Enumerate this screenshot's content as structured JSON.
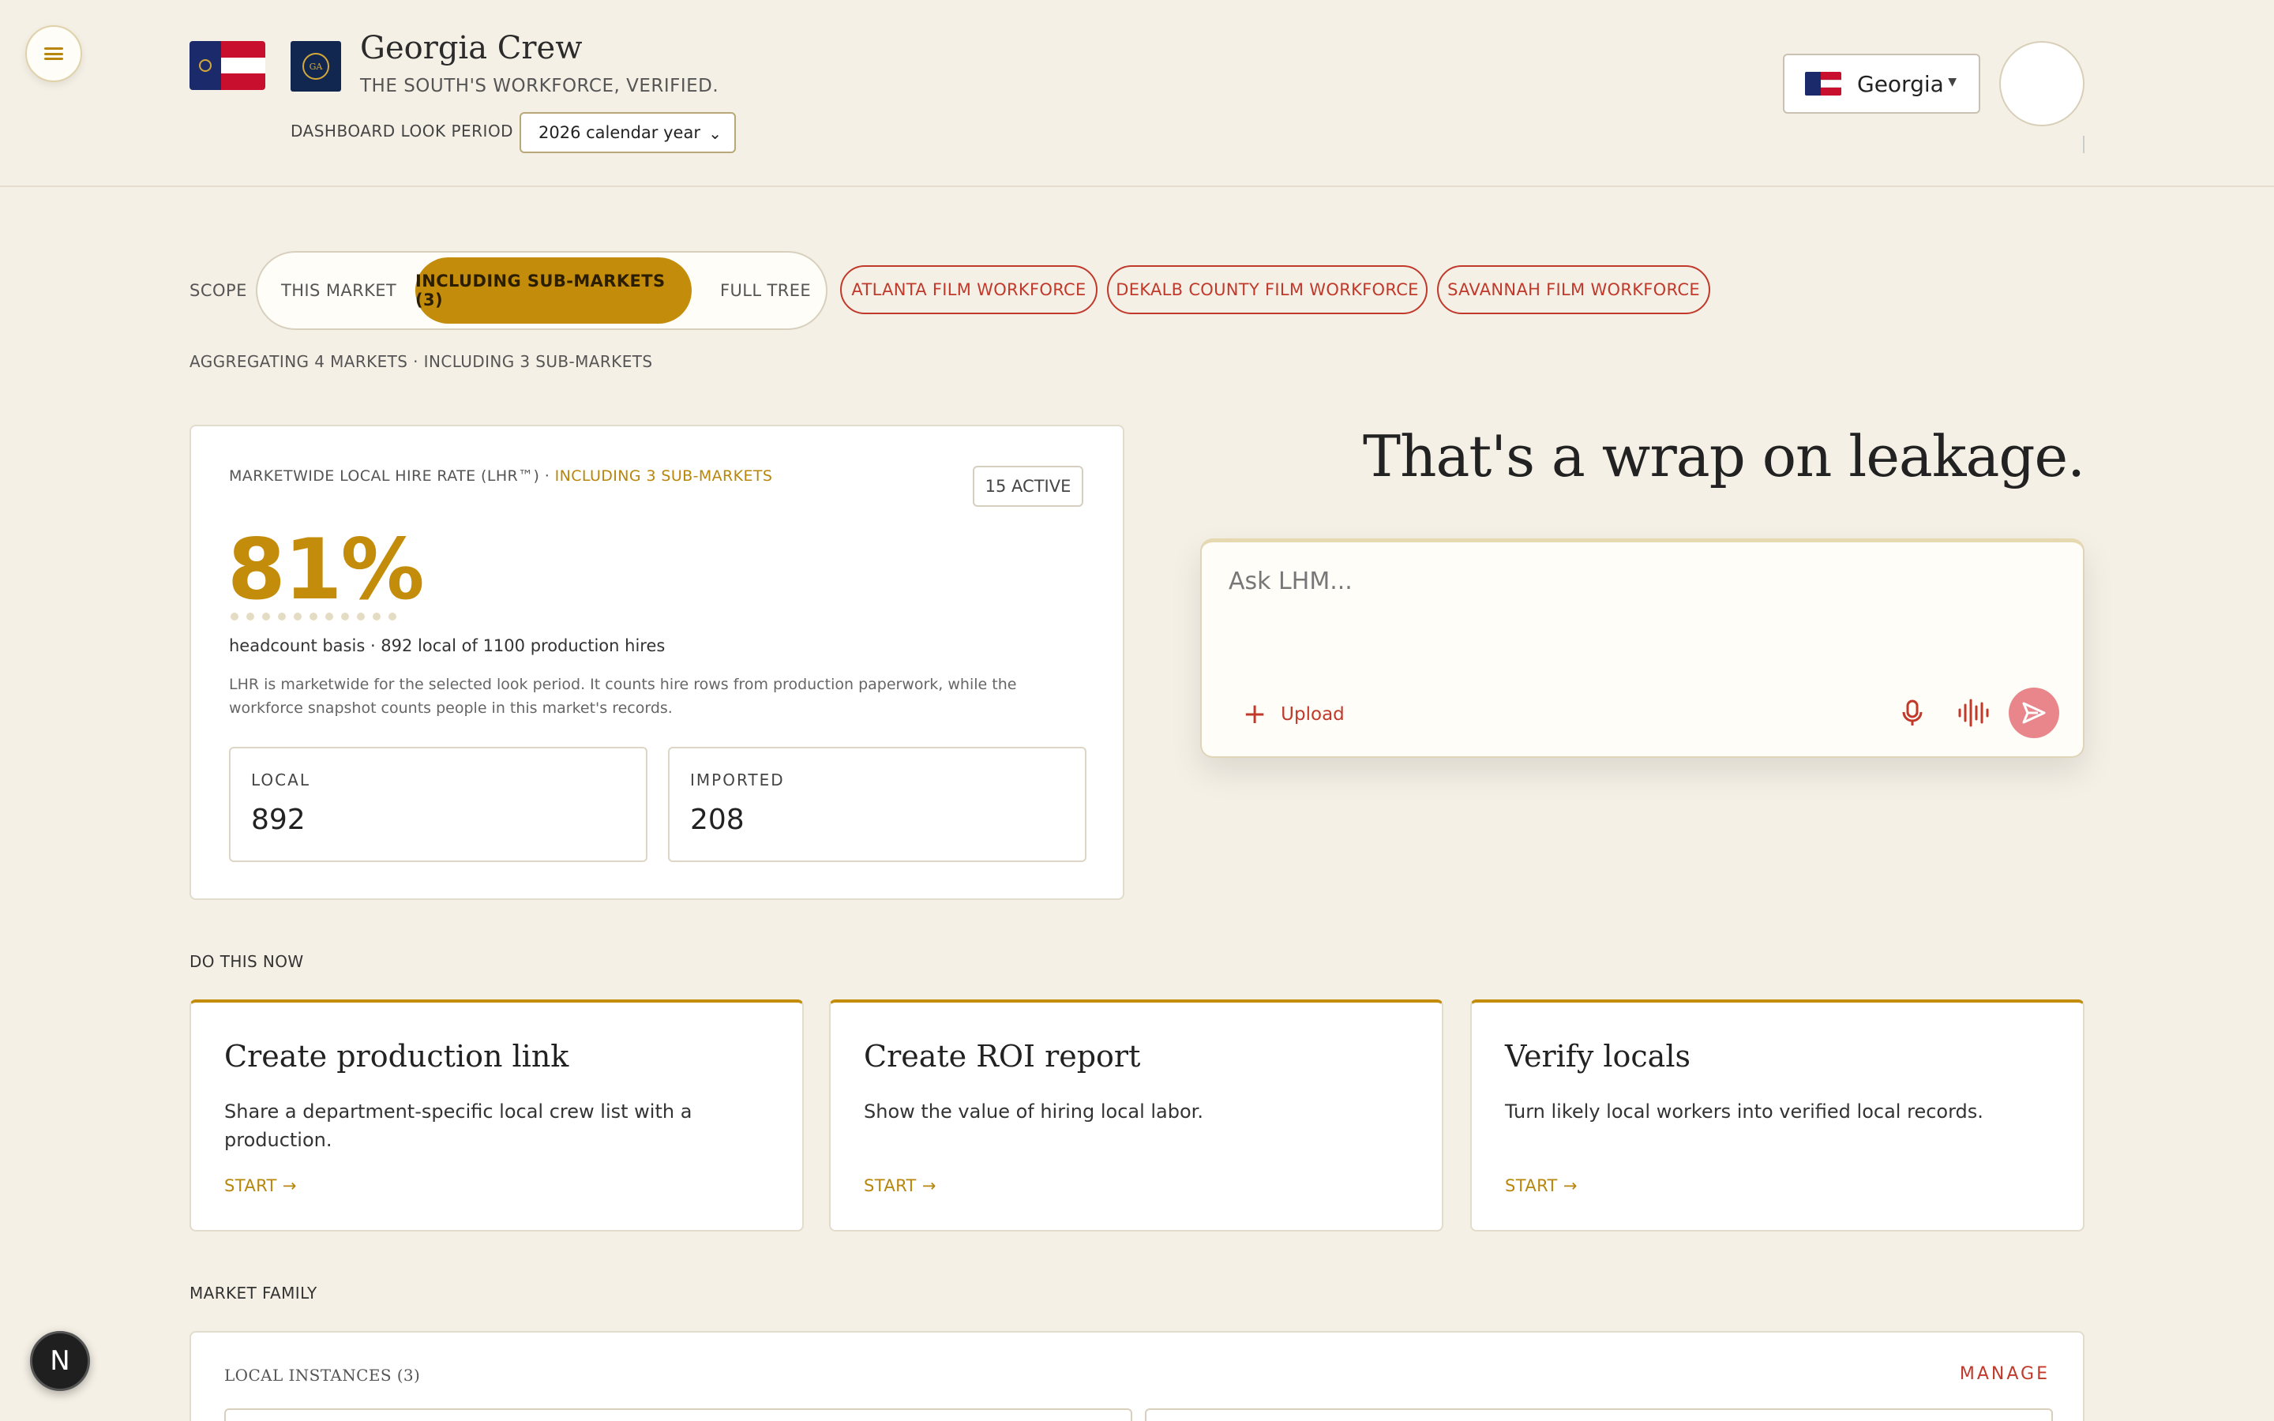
{
  "header": {
    "brand_title": "Georgia Crew",
    "tagline": "THE SOUTH'S WORKFORCE, VERIFIED.",
    "period_label": "DASHBOARD LOOK PERIOD",
    "period_value": "2026 calendar year",
    "seal_text": "GA",
    "region_label": "Georgia"
  },
  "scope": {
    "label": "SCOPE",
    "options": [
      "THIS MARKET",
      "INCLUDING SUB-MARKETS (3)",
      "FULL TREE"
    ],
    "selected": "INCLUDING SUB-MARKETS (3)",
    "chips": [
      "ATLANTA FILM WORKFORCE",
      "DEKALB COUNTY FILM WORKFORCE",
      "SAVANNAH FILM WORKFORCE"
    ],
    "aggregation": "AGGREGATING 4 MARKETS · INCLUDING 3 SUB-MARKETS"
  },
  "lhr": {
    "title": "MARKETWIDE LOCAL HIRE RATE (LHR™) · ",
    "title_scope": "INCLUDING 3 SUB-MARKETS",
    "active_badge": "15 ACTIVE",
    "rate": "81%",
    "rate_value": 0.81,
    "basis": "headcount basis · 892 local of 1100 production hires",
    "description": "LHR is marketwide for the selected look period. It counts hire rows from production paperwork, while the workforce snapshot counts people in this market's records.",
    "local_label": "LOCAL",
    "local_value": "892",
    "imported_label": "IMPORTED",
    "imported_value": "208"
  },
  "hero": {
    "headline": "That's a wrap on leakage.",
    "ask_placeholder": "Ask LHM...",
    "upload_label": "Upload"
  },
  "do_now": {
    "label": "DO THIS NOW",
    "cards": [
      {
        "title": "Create production link",
        "desc": "Share a department-specific local crew list with a production.",
        "cta": "START →"
      },
      {
        "title": "Create ROI report",
        "desc": "Show the value of hiring local labor.",
        "cta": "START →"
      },
      {
        "title": "Verify locals",
        "desc": "Turn likely local workers into verified local records.",
        "cta": "START →"
      }
    ]
  },
  "family": {
    "label": "MARKET FAMILY",
    "instances_label": "LOCAL INSTANCES (3)",
    "manage_label": "MANAGE"
  },
  "dev_badge": "N",
  "colors": {
    "accent_gold": "#c38d0b",
    "accent_red": "#c0392b",
    "background": "#f5f0e6"
  },
  "icons": [
    "menu-icon",
    "chevron-down-icon",
    "plus-icon",
    "microphone-icon",
    "waveform-icon",
    "send-icon"
  ]
}
